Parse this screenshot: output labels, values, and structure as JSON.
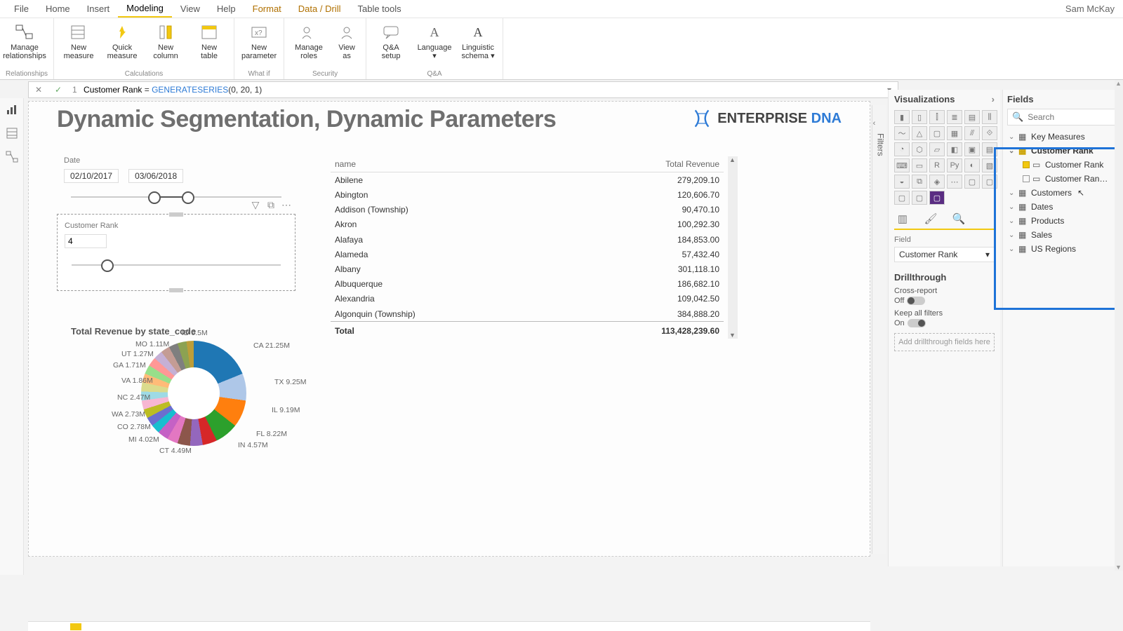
{
  "user": "Sam McKay",
  "menu": {
    "tabs": [
      "File",
      "Home",
      "Insert",
      "Modeling",
      "View",
      "Help",
      "Format",
      "Data / Drill",
      "Table tools"
    ],
    "active": "Modeling"
  },
  "ribbon": {
    "relationships": {
      "label": "Relationships",
      "manage": "Manage\nrelationships"
    },
    "calculations": {
      "label": "Calculations",
      "newMeasure": "New\nmeasure",
      "quickMeasure": "Quick\nmeasure",
      "newColumn": "New\ncolumn",
      "newTable": "New\ntable"
    },
    "whatif": {
      "label": "What if",
      "newParam": "New\nparameter"
    },
    "security": {
      "label": "Security",
      "manageRoles": "Manage\nroles",
      "viewAs": "View\nas"
    },
    "qa": {
      "label": "Q&A",
      "setup": "Q&A\nsetup",
      "language": "Language\n▾",
      "schema": "Linguistic\nschema ▾"
    }
  },
  "formula": {
    "lineNo": "1",
    "name": "Customer Rank",
    "eq": " = ",
    "fn": "GENERATESERIES",
    "args": "(0, 20, 1)"
  },
  "canvas": {
    "title": "Dynamic Segmentation, Dynamic Parameters",
    "brand1": "ENTERPRISE ",
    "brand2": "DNA",
    "date": {
      "label": "Date",
      "from": "02/10/2017",
      "to": "03/06/2018"
    },
    "rank": {
      "label": "Customer Rank",
      "value": "4"
    }
  },
  "table": {
    "col1": "name",
    "col2": "Total Revenue",
    "rows": [
      [
        "Abilene",
        "279,209.10"
      ],
      [
        "Abington",
        "120,606.70"
      ],
      [
        "Addison (Township)",
        "90,470.10"
      ],
      [
        "Akron",
        "100,292.30"
      ],
      [
        "Alafaya",
        "184,853.00"
      ],
      [
        "Alameda",
        "57,432.40"
      ],
      [
        "Albany",
        "301,118.10"
      ],
      [
        "Albuquerque",
        "186,682.10"
      ],
      [
        "Alexandria",
        "109,042.50"
      ],
      [
        "Algonquin (Township)",
        "384,888.20"
      ]
    ],
    "totalLabel": "Total",
    "totalValue": "113,428,239.60"
  },
  "chart_data": {
    "type": "pie",
    "title": "Total Revenue by state_code",
    "slices": [
      {
        "label": "CA",
        "value": 21.25,
        "unit": "M"
      },
      {
        "label": "TX",
        "value": 9.25,
        "unit": "M"
      },
      {
        "label": "IL",
        "value": 9.19,
        "unit": "M"
      },
      {
        "label": "FL",
        "value": 8.22,
        "unit": "M"
      },
      {
        "label": "IN",
        "value": 4.57,
        "unit": "M"
      },
      {
        "label": "CT",
        "value": 4.49,
        "unit": "M"
      },
      {
        "label": "MI",
        "value": 4.02,
        "unit": "M"
      },
      {
        "label": "CO",
        "value": 2.78,
        "unit": "M"
      },
      {
        "label": "WA",
        "value": 2.73,
        "unit": "M"
      },
      {
        "label": "NC",
        "value": 2.47,
        "unit": "M"
      },
      {
        "label": "VA",
        "value": 1.86,
        "unit": "M"
      },
      {
        "label": "GA",
        "value": 1.71,
        "unit": "M"
      },
      {
        "label": "UT",
        "value": 1.27,
        "unit": "M"
      },
      {
        "label": "MO",
        "value": 1.11,
        "unit": "M"
      },
      {
        "label": "ID",
        "value": 0.5,
        "unit": "M"
      }
    ]
  },
  "donut": {
    "title": "Total Revenue by state_code",
    "l_ca": "CA 21.25M",
    "l_tx": "TX 9.25M",
    "l_il": "IL 9.19M",
    "l_fl": "FL 8.22M",
    "l_in": "IN 4.57M",
    "l_ct": "CT 4.49M",
    "l_mi": "MI 4.02M",
    "l_co": "CO 2.78M",
    "l_wa": "WA 2.73M",
    "l_nc": "NC 2.47M",
    "l_va": "VA 1.86M",
    "l_ga": "GA 1.71M",
    "l_ut": "UT 1.27M",
    "l_mo": "MO 1.11M",
    "l_id": "ID 0.5M"
  },
  "filters": {
    "tab": "Filters"
  },
  "vispane": {
    "title": "Visualizations",
    "fieldLabel": "Field",
    "fieldValue": "Customer Rank",
    "drill": "Drillthrough",
    "cross": "Cross-report",
    "off": "Off",
    "keep": "Keep all filters",
    "on": "On",
    "drop": "Add drillthrough fields here"
  },
  "fields": {
    "title": "Fields",
    "searchPH": "Search",
    "nodes": {
      "keyMeasures": "Key Measures",
      "customerRank": "Customer Rank",
      "crField": "Customer Rank",
      "crField2": "Customer Ran…",
      "customers": "Customers",
      "dates": "Dates",
      "products": "Products",
      "sales": "Sales",
      "usregions": "US Regions"
    }
  }
}
